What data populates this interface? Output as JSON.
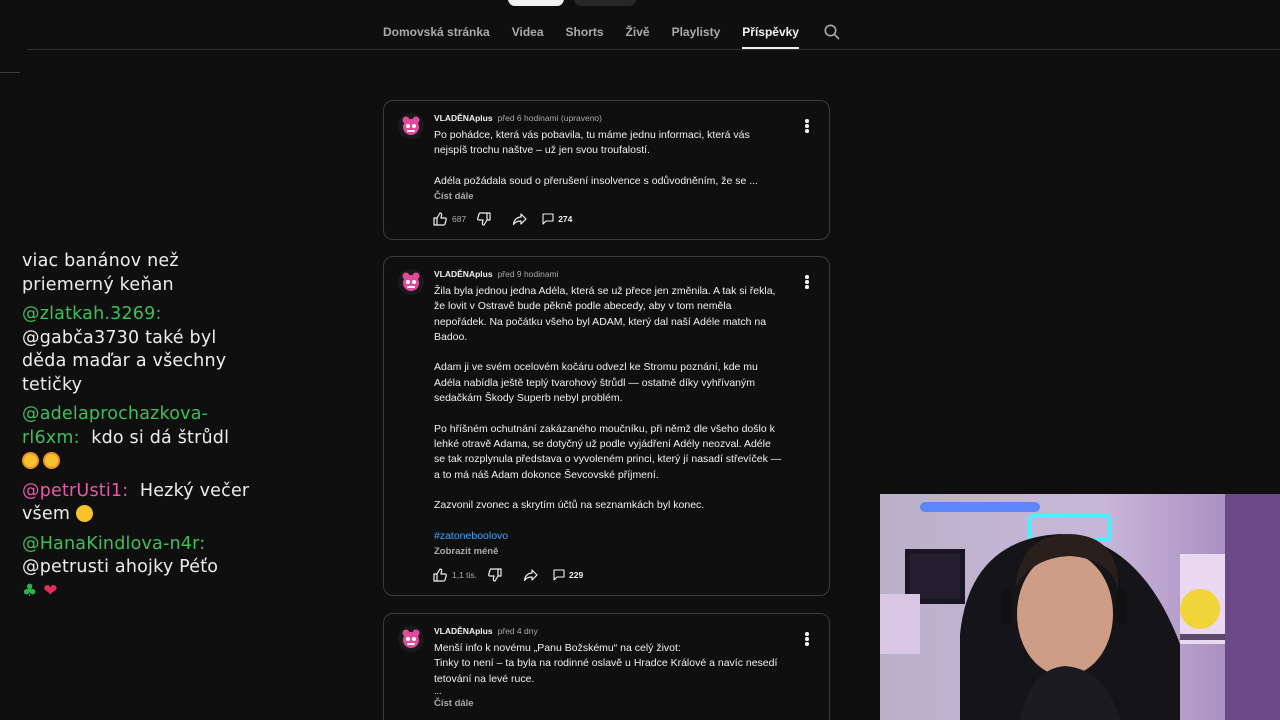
{
  "tabs": [
    {
      "label": "Domovská stránka",
      "active": false
    },
    {
      "label": "Videa",
      "active": false
    },
    {
      "label": "Shorts",
      "active": false
    },
    {
      "label": "Živě",
      "active": false
    },
    {
      "label": "Playlisty",
      "active": false
    },
    {
      "label": "Příspěvky",
      "active": true
    }
  ],
  "search_icon": "search-icon",
  "chat": {
    "m0": {
      "text": "viac banánov než priemerný keňan"
    },
    "m1": {
      "user": "@zlatkah.3269",
      "sep": ":",
      "text": "@gabča3730 také byl děda maďar a všechny tetičky"
    },
    "m2": {
      "user": "@adelaprochazkova-rl6xm",
      "sep": ":",
      "text": "kdo si dá štrůdl"
    },
    "m3": {
      "user": "@petrUsti1",
      "sep": ":",
      "text": "Hezký večer všem"
    },
    "m4": {
      "user": "@HanaKindlova-n4r",
      "sep": ":",
      "text": "@petrusti ahojky Péťo"
    }
  },
  "posts": [
    {
      "author": "VLADĚNAplus",
      "time": "před 6 hodinami (upraveno)",
      "p1": "Po pohádce, která vás pobavila, tu máme jednu informaci, která vás nejspíš trochu naštve – už jen svou troufalostí.",
      "p2": "Adéla požádala soud o přerušení insolvence s odůvodněním, že se ...",
      "more": "Číst dále",
      "likes": "687",
      "comments": "274"
    },
    {
      "author": "VLADĚNAplus",
      "time": "před 9 hodinami",
      "p1": "Žila byla jednou jedna Adéla, která se už přece jen změnila. A tak si řekla, že lovit v Ostravě bude pěkně podle abecedy, aby v tom neměla nepořádek. Na počátku všeho byl ADAM, který dal naší Adéle match na Badoo.",
      "p2": "Adam ji ve svém ocelovém kočáru odvezl ke Stromu poznání, kde mu Adéla nabídla ještě teplý tvarohový štrůdl — ostatně díky vyhřívaným sedačkám Škody Superb nebyl problém.",
      "p3": "Po hříšném ochutnání zakázaného moučníku, při němž dle všeho došlo k lehké otravě Adama, se dotyčný už podle vyjádření Adély neozval. Adéle se tak rozplynula představa o vyvoleném princi, který jí nasadí střevíček — a to má náš Adam dokonce Ševcovské příjmení.",
      "p4": "Zazvonil zvonec a skrytím účtů na seznamkách byl konec.",
      "hashtag": "#zatoneboolovo",
      "less": "Zobrazit méně",
      "likes": "1,1 tis.",
      "comments": "229"
    },
    {
      "author": "VLADĚNAplus",
      "time": "před 4 dny",
      "p1": "Menší info k novému „Panu Božskému“ na celý život:",
      "p2": "Tinky to není – ta byla na rodinné oslavě u Hradce Králové a navíc nesedí tetování na levé ruce.",
      "ellipsis": "...",
      "more": "Číst dále"
    }
  ],
  "colors": {
    "bg": "#0f0f0f",
    "link": "#3ea6ff",
    "chat_green": "#3fbf5a",
    "chat_pink": "#e85aa8"
  }
}
